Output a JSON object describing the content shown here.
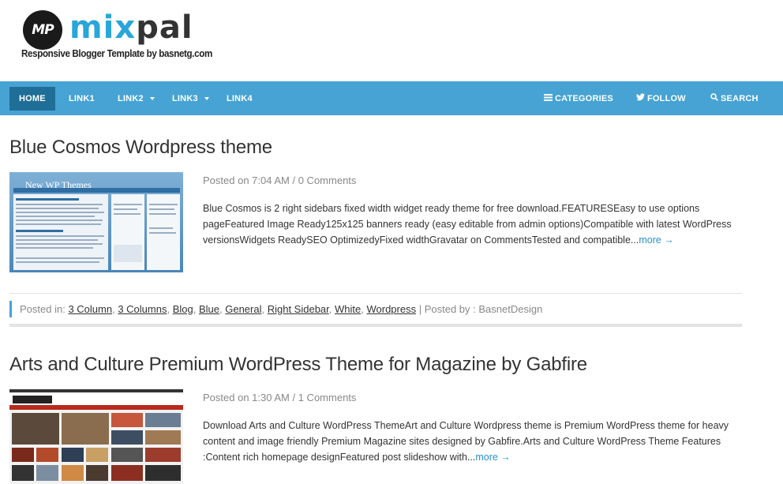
{
  "logo": {
    "badge": "MP",
    "word_part1": "mix",
    "word_part2": "pal",
    "tagline": "Responsive Blogger Template by basnetg.com"
  },
  "nav": {
    "left": [
      {
        "label": "HOME",
        "active": true,
        "dropdown": false
      },
      {
        "label": "LINK1",
        "active": false,
        "dropdown": false
      },
      {
        "label": "LINK2",
        "active": false,
        "dropdown": true
      },
      {
        "label": "LINK3",
        "active": false,
        "dropdown": true
      },
      {
        "label": "LINK4",
        "active": false,
        "dropdown": false
      }
    ],
    "right": [
      {
        "label": "CATEGORIES",
        "icon": "list-icon"
      },
      {
        "label": "FOLLOW",
        "icon": "twitter-icon"
      },
      {
        "label": "SEARCH",
        "icon": "search-icon"
      }
    ]
  },
  "colors": {
    "nav_bg": "#46a3d3",
    "nav_active": "#1f6e97",
    "link": "#2a8fc9",
    "brand_blue": "#29a6d9"
  },
  "posts": [
    {
      "title": "Blue Cosmos Wordpress theme",
      "posted_prefix": "Posted on",
      "time": "7:04 AM",
      "comments": "0 Comments",
      "excerpt": "Blue Cosmos is 2 right sidebars fixed width widget ready theme for free download.FEATURESEasy to use options pageFeatured Image Ready125x125 banners ready (easy editable from admin options)Compatible with latest WordPress versionsWidgets ReadySEO OptimizedyFixed widthGravatar on CommentsTested and compatible...",
      "more": "more →",
      "thumb_title": "New WP Themes",
      "posted_in_label": "Posted in:",
      "categories": [
        "3 Column",
        "3 Columns",
        "Blog",
        "Blue",
        "General",
        "Right Sidebar",
        "White",
        "Wordpress"
      ],
      "posted_by_label": "| Posted by : BasnetDesign"
    },
    {
      "title": "Arts and Culture Premium WordPress Theme for Magazine by Gabfire",
      "posted_prefix": "Posted on",
      "time": "1:30 AM",
      "comments": "1 Comments",
      "excerpt": "Download Arts and Culture WordPress ThemeArt and Culture Wordpress theme is Premium WordPress theme for heavy content and image friendly Premium Magazine sites designed by Gabfire.Arts and Culture WordPress Theme Features :Content rich homepage designFeatured post slideshow with...",
      "more": "more →"
    }
  ]
}
